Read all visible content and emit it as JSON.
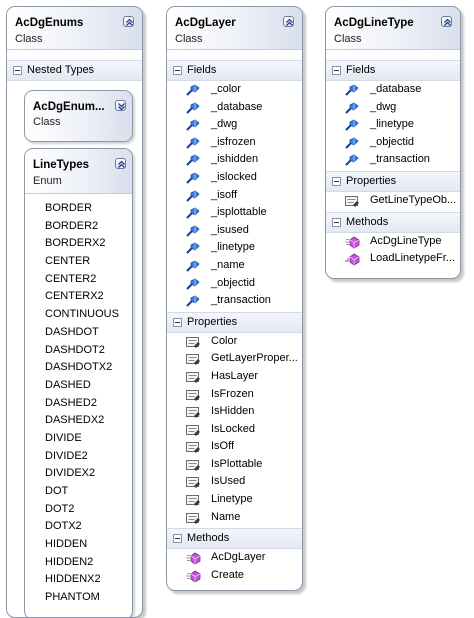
{
  "acdgenums": {
    "title": "AcDgEnums",
    "kind": "Class",
    "nested_types_label": "Nested Types",
    "nested_class": {
      "title": "AcDgEnum...",
      "kind": "Class"
    },
    "linetypes": {
      "title": "LineTypes",
      "kind": "Enum",
      "items": [
        "BORDER",
        "BORDER2",
        "BORDERX2",
        "CENTER",
        "CENTER2",
        "CENTERX2",
        "CONTINUOUS",
        "DASHDOT",
        "DASHDOT2",
        "DASHDOTX2",
        "DASHED",
        "DASHED2",
        "DASHEDX2",
        "DIVIDE",
        "DIVIDE2",
        "DIVIDEX2",
        "DOT",
        "DOT2",
        "DOTX2",
        "HIDDEN",
        "HIDDEN2",
        "HIDDENX2",
        "PHANTOM"
      ]
    }
  },
  "acdglayer": {
    "title": "AcDgLayer",
    "kind": "Class",
    "fields_label": "Fields",
    "fields": [
      "_color",
      "_database",
      "_dwg",
      "_isfrozen",
      "_ishidden",
      "_islocked",
      "_isoff",
      "_isplottable",
      "_isused",
      "_linetype",
      "_name",
      "_objectid",
      "_transaction"
    ],
    "properties_label": "Properties",
    "properties": [
      "Color",
      "GetLayerProper...",
      "HasLayer",
      "IsFrozen",
      "IsHidden",
      "IsLocked",
      "IsOff",
      "IsPlottable",
      "IsUsed",
      "Linetype",
      "Name"
    ],
    "methods_label": "Methods",
    "methods": [
      "AcDgLayer",
      "Create"
    ]
  },
  "acdglinetype": {
    "title": "AcDgLineType",
    "kind": "Class",
    "fields_label": "Fields",
    "fields": [
      "_database",
      "_dwg",
      "_linetype",
      "_objectid",
      "_transaction"
    ],
    "properties_label": "Properties",
    "properties": [
      "GetLineTypeOb..."
    ],
    "methods_label": "Methods",
    "methods": [
      "AcDgLineType",
      "LoadLinetypeFr..."
    ]
  },
  "icons": {
    "collapse": "double-chevron-up-icon",
    "expand": "double-chevron-down-icon",
    "field": "field-icon",
    "property": "property-icon",
    "method": "method-icon",
    "compartment_toggle": "minus-toggle-icon"
  },
  "colors": {
    "field_icon": "#2f6fd6",
    "method_icon": "#b23bc9",
    "header_gradient_end": "#d9dfec",
    "border": "#8c97a8"
  }
}
